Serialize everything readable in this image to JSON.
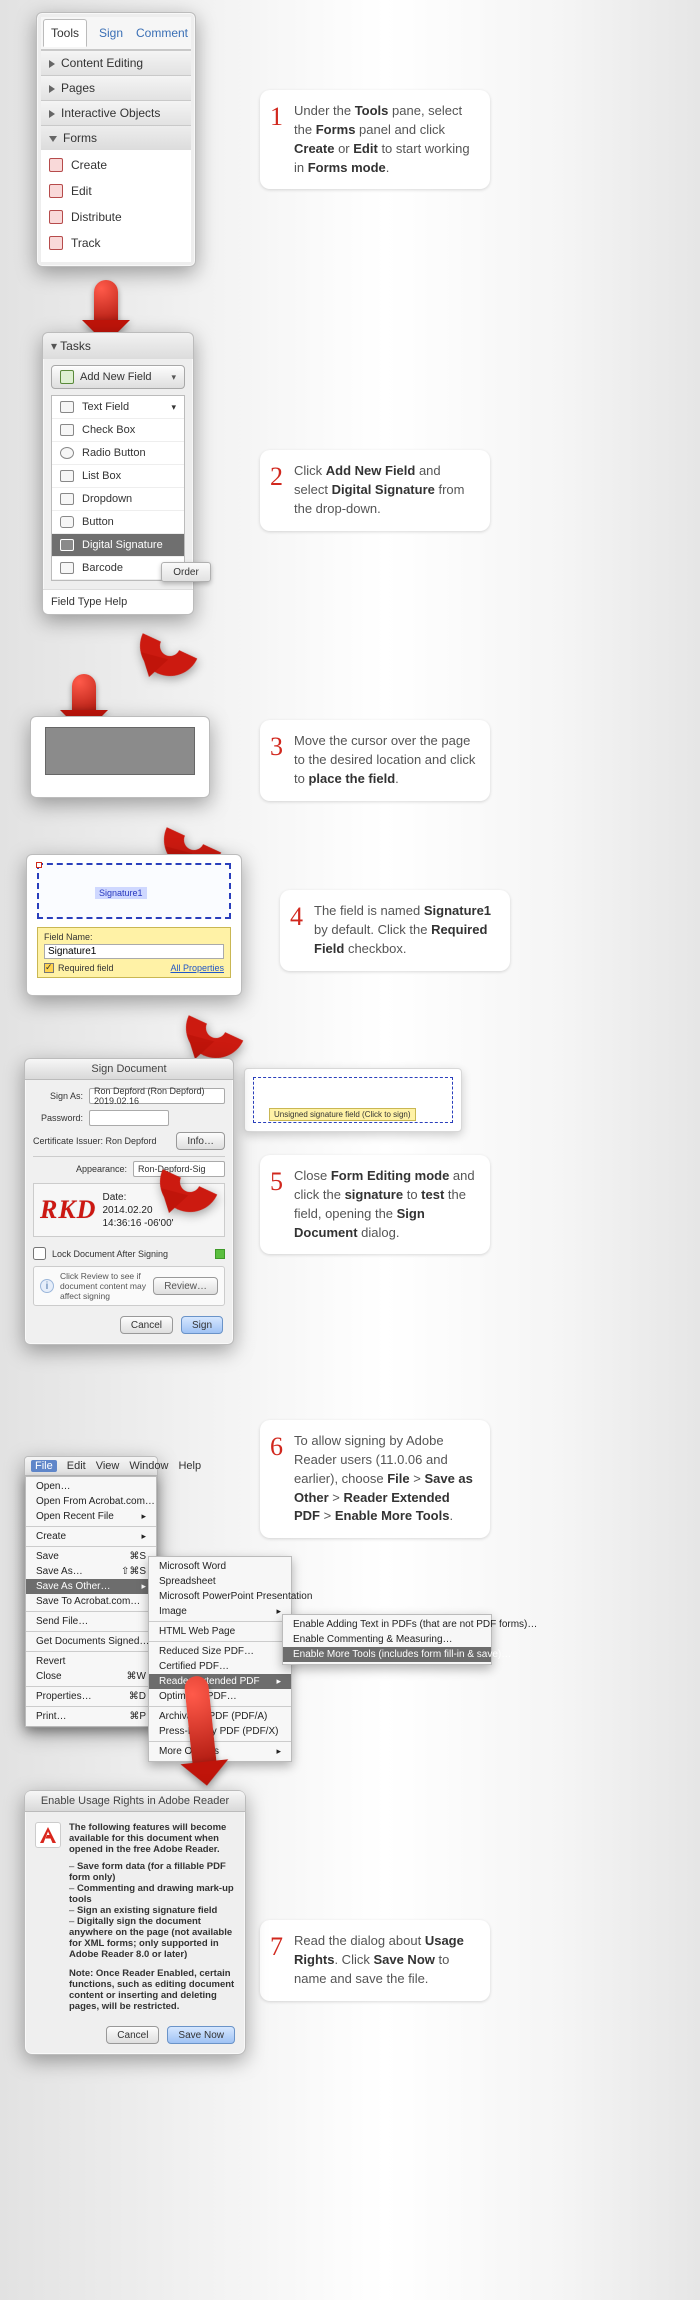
{
  "panel1": {
    "tabs": {
      "tools": "Tools",
      "sign": "Sign",
      "comment": "Comment"
    },
    "rows": {
      "content_editing": "Content Editing",
      "pages": "Pages",
      "interactive_objects": "Interactive Objects",
      "forms": "Forms"
    },
    "forms_items": {
      "create": "Create",
      "edit": "Edit",
      "distribute": "Distribute",
      "track": "Track"
    }
  },
  "panel2": {
    "header": "Tasks",
    "add_new_field": "Add New Field",
    "items": {
      "text_field": "Text Field",
      "check_box": "Check Box",
      "radio_button": "Radio Button",
      "list_box": "List Box",
      "dropdown": "Dropdown",
      "button": "Button",
      "digital_signature": "Digital Signature",
      "barcode": "Barcode"
    },
    "footer": "Field Type Help",
    "order_chip": "Order"
  },
  "panel4": {
    "sig_label": "Signature1",
    "field_name_label": "Field Name:",
    "field_name_value": "Signature1",
    "required_label": "Required field",
    "all_properties": "All Properties"
  },
  "panel5": {
    "title": "Sign Document",
    "sign_as_label": "Sign As:",
    "sign_as_value": "Ron Depford (Ron Depford) 2019.02.16",
    "password_label": "Password:",
    "cert_issuer_label": "Certificate Issuer: Ron Depford",
    "info_btn": "Info…",
    "appearance_label": "Appearance:",
    "appearance_value": "Ron-Depford-Sig",
    "rkd": "RKD",
    "sig_date_label": "Date:",
    "sig_date_value1": "2014.02.20",
    "sig_date_value2": "14:36:16 -06'00'",
    "lock_label": "Lock Document After Signing",
    "info_text": "Click Review to see if document content may affect signing",
    "review_btn": "Review…",
    "cancel_btn": "Cancel",
    "sign_btn": "Sign",
    "unsigned_hint": "Unsigned signature field (Click to sign)"
  },
  "panel6": {
    "menubar": {
      "file": "File",
      "edit": "Edit",
      "view": "View",
      "window": "Window",
      "help": "Help"
    },
    "file_menu": {
      "open": "Open…",
      "open_from_acrobat": "Open From Acrobat.com…",
      "open_recent": "Open Recent File",
      "create": "Create",
      "save": "Save",
      "save_as": "Save As…",
      "save_as_other": "Save As Other…",
      "save_to_acrobat": "Save To Acrobat.com…",
      "send_file": "Send File…",
      "get_docs_signed": "Get Documents Signed…",
      "revert": "Revert",
      "close": "Close",
      "properties": "Properties…",
      "print": "Print…",
      "shortcut_save": "⌘S",
      "shortcut_saveas": "⇧⌘S",
      "shortcut_close": "⌘W",
      "shortcut_props": "⌘D",
      "shortcut_print": "⌘P"
    },
    "sao_menu": {
      "word": "Microsoft Word",
      "spreadsheet": "Spreadsheet",
      "ppt": "Microsoft PowerPoint Presentation",
      "image": "Image",
      "html": "HTML Web Page",
      "reduced": "Reduced Size PDF…",
      "certified": "Certified PDF…",
      "reader_ext": "Reader Extended PDF",
      "optimized": "Optimized PDF…",
      "archivable": "Archivable PDF (PDF/A)",
      "press_ready": "Press-Ready PDF (PDF/X)",
      "more": "More Options"
    },
    "rep_menu": {
      "add_text": "Enable Adding Text in PDFs (that are not PDF forms)…",
      "commenting": "Enable Commenting & Measuring…",
      "more_tools": "Enable More Tools (includes form fill-in & save)…"
    }
  },
  "panel7": {
    "title": "Enable Usage Rights in Adobe Reader",
    "intro": "The following features will become available for this document when opened in the free Adobe Reader.",
    "bullets": {
      "b1": "Save form data (for a fillable PDF form only)",
      "b2": "Commenting and drawing mark-up tools",
      "b3": "Sign an existing signature field",
      "b4": "Digitally sign the document anywhere on the page (not available for XML forms; only supported in Adobe Reader 8.0 or later)"
    },
    "note": "Note: Once Reader Enabled, certain functions, such as editing document content or inserting and deleting pages, will be restricted.",
    "cancel": "Cancel",
    "save_now": "Save Now"
  },
  "steps": {
    "s1a": "Under the ",
    "s1b": "Tools",
    "s1c": " pane, select the ",
    "s1d": "Forms",
    "s1e": " panel and click ",
    "s1f": "Create",
    "s1g": " or ",
    "s1h": "Edit",
    "s1i": " to start working in ",
    "s1j": "Forms mode",
    "s1k": ".",
    "s2a": "Click ",
    "s2b": "Add New Field",
    "s2c": " and select ",
    "s2d": "Digital Signature",
    "s2e": " from the drop-down.",
    "s3a": "Move the cursor over the page to the desired location and click to ",
    "s3b": "place the field",
    "s3c": ".",
    "s4a": " The field is named ",
    "s4b": "Signature1",
    "s4c": " by default. Click the ",
    "s4d": "Required Field",
    "s4e": " checkbox.",
    "s5a": "Close ",
    "s5b": "Form Editing mode",
    "s5c": " and click the ",
    "s5d": "signature",
    "s5e": " to ",
    "s5f": "test",
    "s5g": " the field, opening the ",
    "s5h": "Sign Document",
    "s5i": " dialog.",
    "s6a": "To allow signing by Adobe Reader users (11.0.06 and earlier), choose ",
    "s6b": "File",
    "s6c": " > ",
    "s6d": "Save as Other",
    "s6e": " > ",
    "s6f": "Reader Extended PDF",
    "s6g": " > ",
    "s6h": "Enable More Tools",
    "s6i": ".",
    "s7a": "Read the dialog about ",
    "s7b": "Usage Rights",
    "s7c": ". Click ",
    "s7d": "Save Now",
    "s7e": " to name and save the file."
  }
}
